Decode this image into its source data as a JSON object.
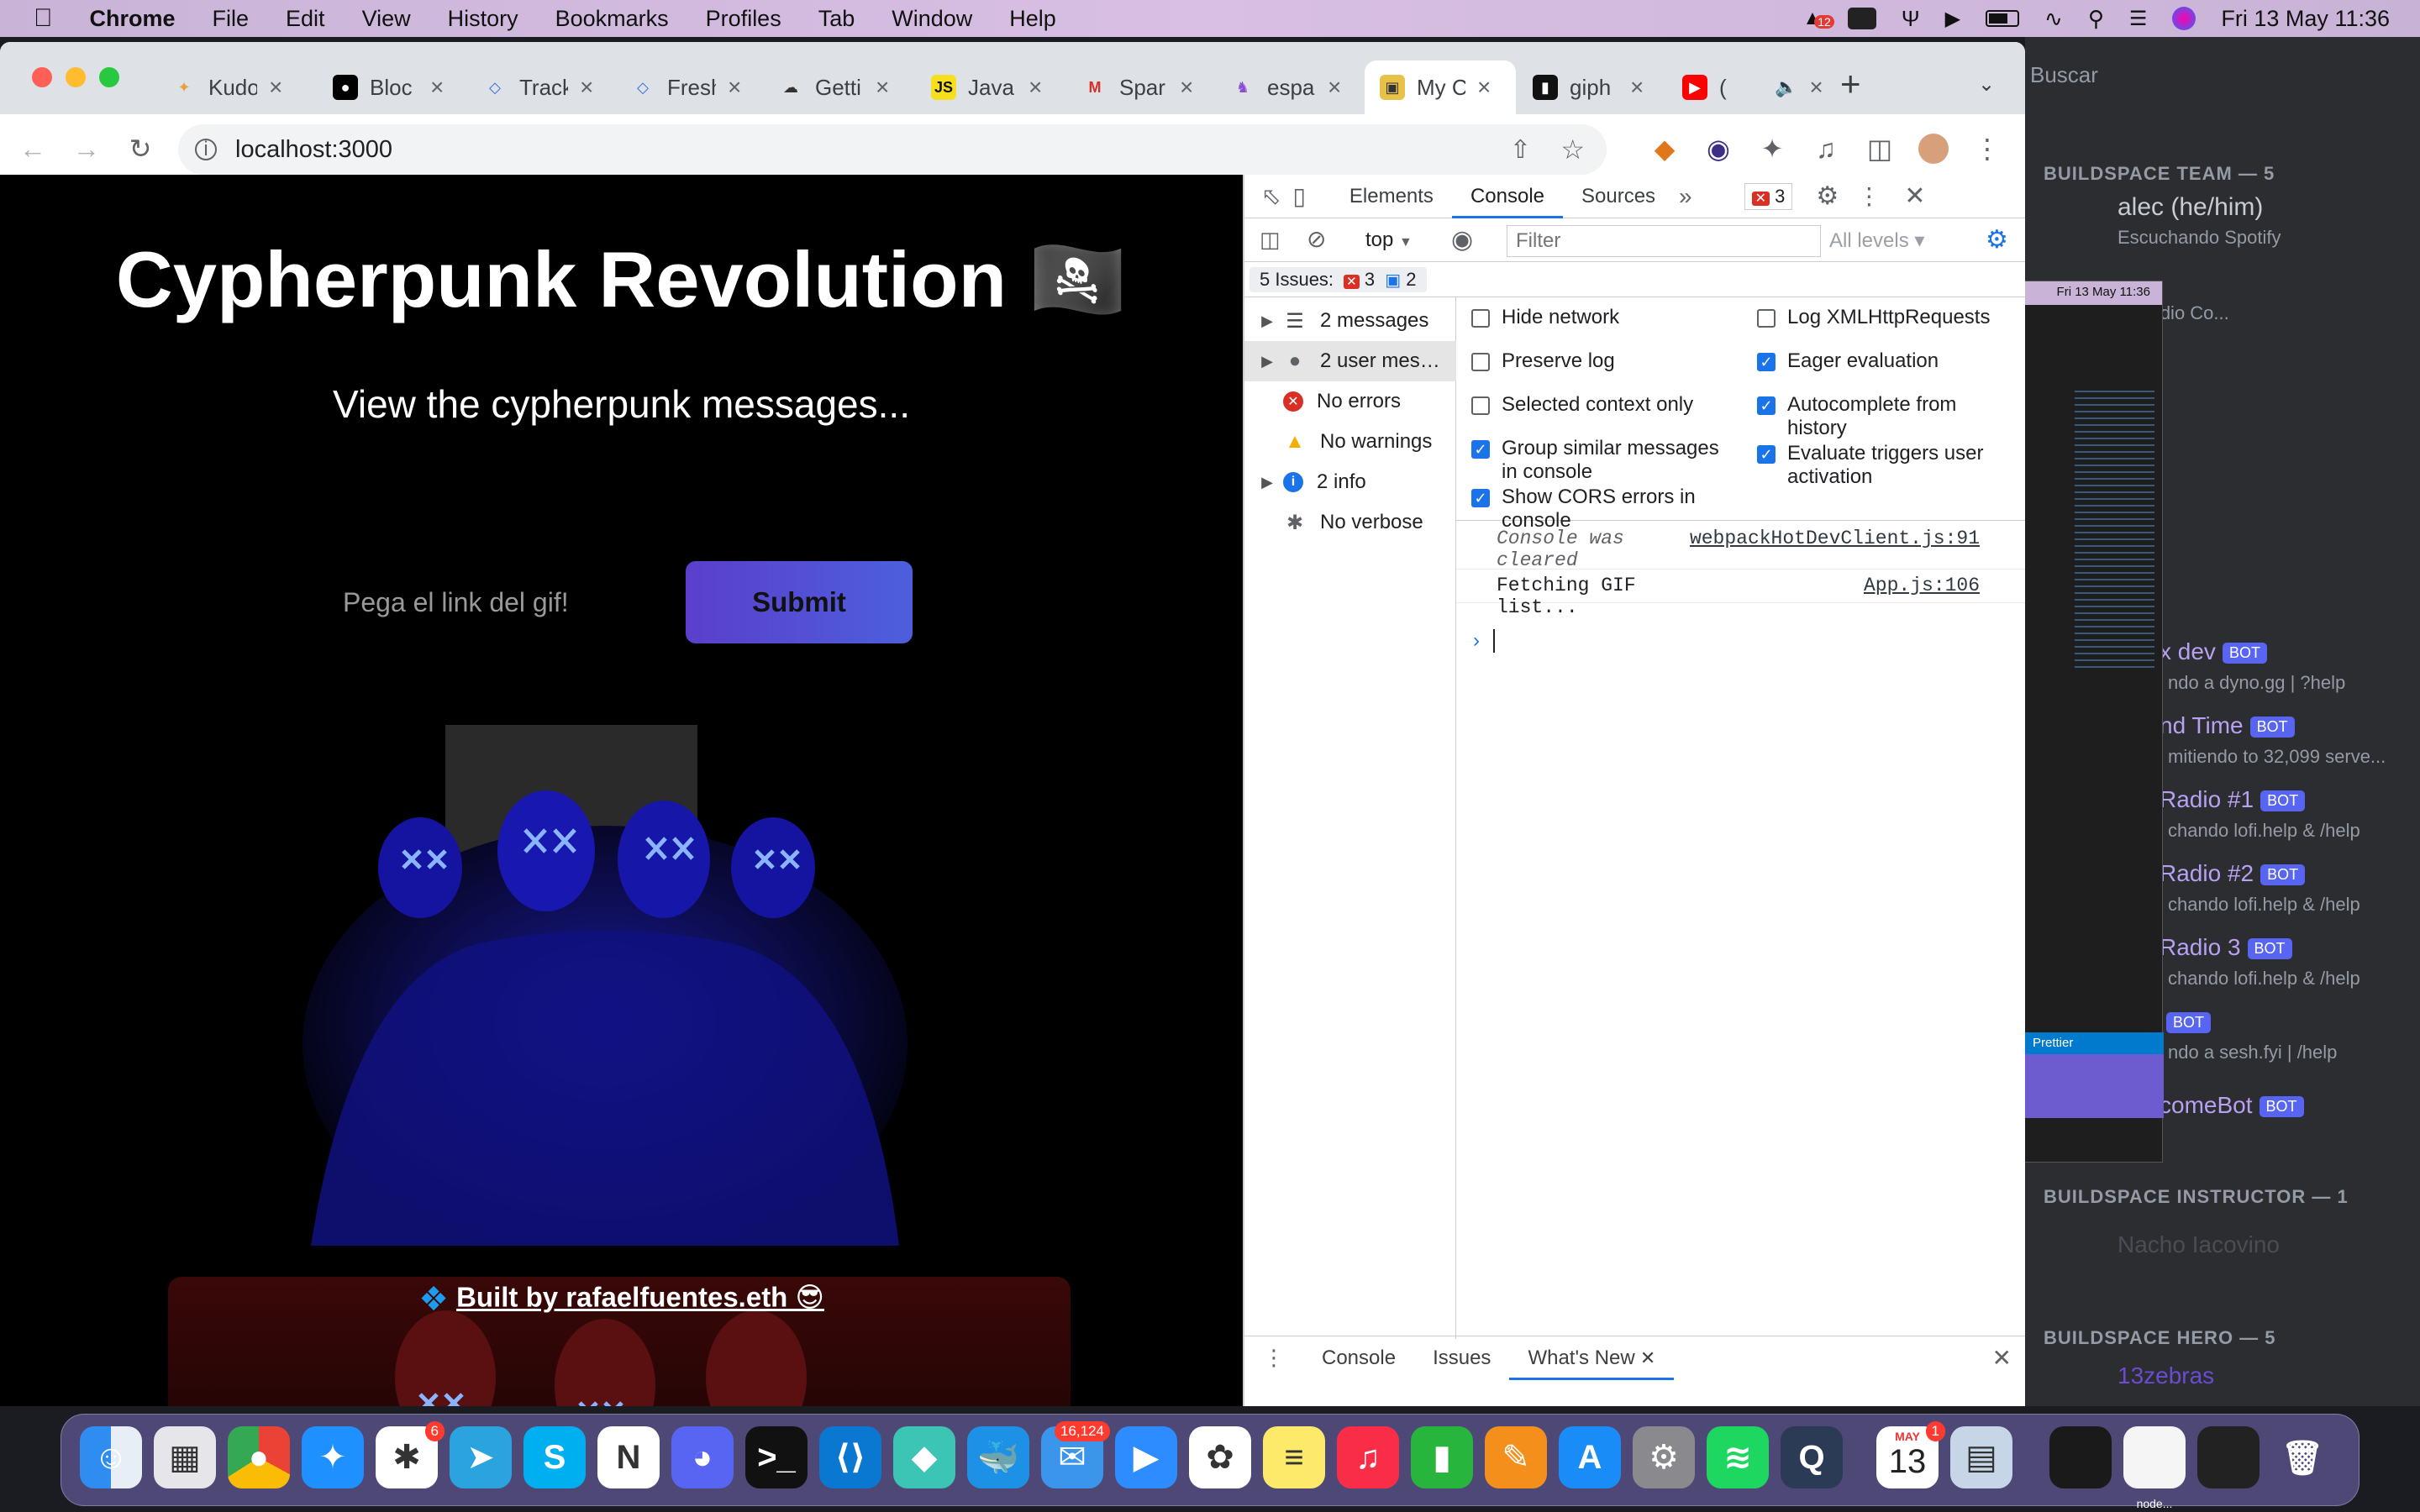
{
  "menubar": {
    "app": "Chrome",
    "items": [
      "File",
      "Edit",
      "View",
      "History",
      "Bookmarks",
      "Profiles",
      "Tab",
      "Window",
      "Help"
    ],
    "badge": "12",
    "datetime": "Fri 13 May  11:36"
  },
  "tabs": [
    {
      "title": "Kudo",
      "icon": "party-icon"
    },
    {
      "title": "Bloc",
      "icon": "medium-icon"
    },
    {
      "title": "Track",
      "icon": "diamond-icon"
    },
    {
      "title": "Fresh",
      "icon": "diamond-icon"
    },
    {
      "title": "Getti",
      "icon": "cloud-icon"
    },
    {
      "title": "Java",
      "icon": "js-icon",
      "favtext": "JS"
    },
    {
      "title": "Spar",
      "icon": "gmail-icon",
      "favtext": "M"
    },
    {
      "title": "espa",
      "icon": "unicorn-icon"
    },
    {
      "title": "My C",
      "icon": "frame-icon"
    },
    {
      "title": "giph",
      "icon": "giphy-icon"
    },
    {
      "title": "(",
      "icon": "youtube-icon"
    }
  ],
  "address": {
    "url": "localhost:3000"
  },
  "page": {
    "title": "Cypherpunk Revolution 🏴‍☠️",
    "subtitle": "View the cypherpunk messages...",
    "input_placeholder": "Pega el link del gif!",
    "submit_label": "Submit",
    "footer_link": "Built by rafaelfuentes.eth 😎"
  },
  "devtools": {
    "tabs": [
      "Elements",
      "Console",
      "Sources"
    ],
    "error_count": "3",
    "context": "top",
    "filter_placeholder": "Filter",
    "levels": "All levels",
    "issues_label": "5 Issues:",
    "issues_errors": "3",
    "issues_info": "2",
    "sidebar": [
      {
        "label": "2 messages",
        "icon": "list-icon",
        "expand": true
      },
      {
        "label": "2 user mes…",
        "icon": "user-icon",
        "expand": true
      },
      {
        "label": "No errors",
        "icon": "error-icon",
        "expand": false
      },
      {
        "label": "No warnings",
        "icon": "warning-icon",
        "expand": false
      },
      {
        "label": "2 info",
        "icon": "info-icon",
        "expand": true
      },
      {
        "label": "No verbose",
        "icon": "bug-icon",
        "expand": false
      }
    ],
    "options_left": [
      {
        "label": "Hide network",
        "checked": false
      },
      {
        "label": "Preserve log",
        "checked": false
      },
      {
        "label": "Selected context only",
        "checked": false
      },
      {
        "label": "Group similar messages in console",
        "checked": true
      },
      {
        "label": "Show CORS errors in console",
        "checked": true
      }
    ],
    "options_right": [
      {
        "label": "Log XMLHttpRequests",
        "checked": false
      },
      {
        "label": "Eager evaluation",
        "checked": true
      },
      {
        "label": "Autocomplete from history",
        "checked": true
      },
      {
        "label": "Evaluate triggers user activation",
        "checked": true
      }
    ],
    "logs": [
      {
        "text": "Console was cleared",
        "source": "webpackHotDevClient.js:91",
        "italic": true
      },
      {
        "text": "Fetching GIF list...",
        "source": "App.js:106",
        "italic": false
      }
    ],
    "drawer_tabs": [
      "Console",
      "Issues",
      "What's New"
    ]
  },
  "discord": {
    "search": "Buscar",
    "section_team": "BUILDSPACE TEAM — 5",
    "user1": "alec (he/him)",
    "user1_status": "Escuchando Spotify",
    "mini_datetime": "Fri 13 May  11:36",
    "rows": [
      {
        "name": "x dev",
        "sub": "ndo a dyno.gg | ?help",
        "bot": "BOT"
      },
      {
        "name": "nd Time",
        "sub": "mitiendo to 32,099 serve...",
        "bot": "BOT"
      },
      {
        "name": "Radio #1",
        "sub": "chando lofi.help & /help",
        "bot": "BOT"
      },
      {
        "name": "Radio #2",
        "sub": "chando lofi.help & /help",
        "bot": "BOT"
      },
      {
        "name": "Radio 3",
        "sub": "chando lofi.help & /help",
        "bot": "BOT"
      },
      {
        "name": "",
        "sub": "ndo a sesh.fyi | /help",
        "bot": "BOT"
      },
      {
        "name": "comeBot",
        "sub": "",
        "bot": "BOT"
      }
    ],
    "vscode_row": "ado a Visual Studio Co...",
    "section_instructor": "BUILDSPACE INSTRUCTOR — 1",
    "instructor": "Nacho Iacovino",
    "section_hero": "BUILDSPACE HERO — 5",
    "hero": "13zebras",
    "prettier": "Prettier"
  },
  "dock": {
    "slack_badge": "6",
    "mail_badge": "16,124",
    "calendar_month": "MAY",
    "calendar_day": "13",
    "calendar_badge": "1",
    "node_label": "node..."
  }
}
